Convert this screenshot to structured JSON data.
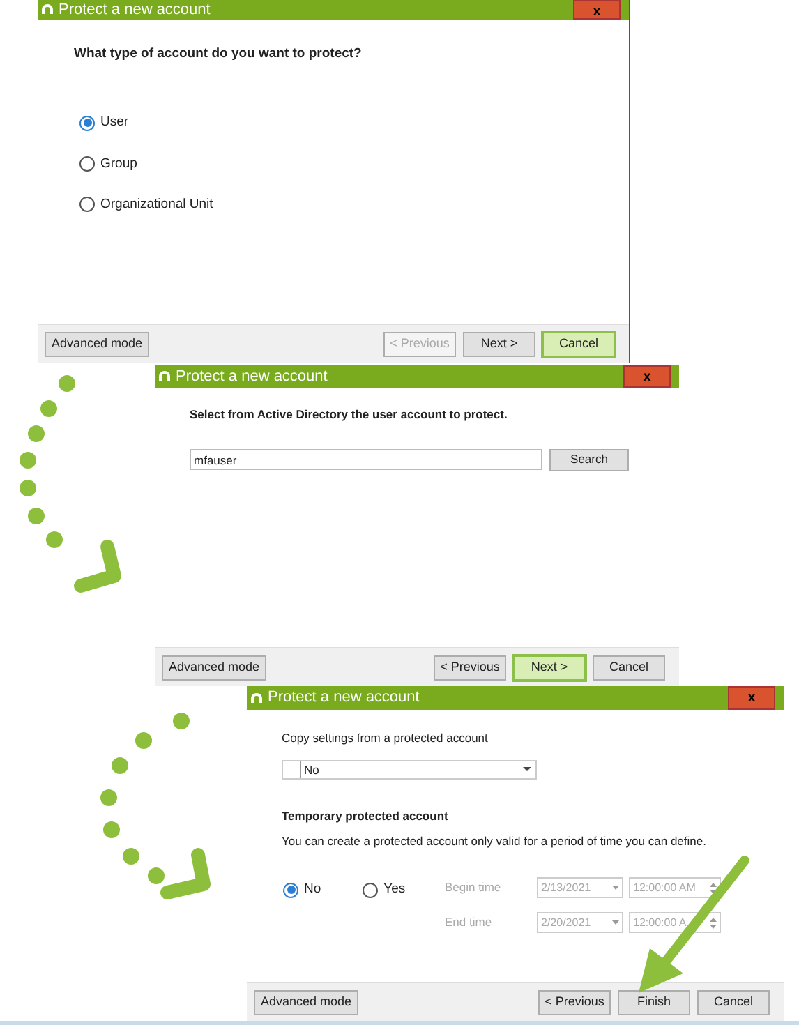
{
  "dialogs": [
    {
      "kind": "account_type",
      "title": "Protect a new account",
      "close": "x",
      "question": "What type of account do you want to protect?",
      "options": [
        {
          "label": "User",
          "selected": true
        },
        {
          "label": "Group",
          "selected": false
        },
        {
          "label": "Organizational Unit",
          "selected": false
        }
      ],
      "advanced": "Advanced mode",
      "buttons": [
        {
          "label": "< Previous",
          "disabled": true,
          "highlighted": false
        },
        {
          "label": "Next >",
          "disabled": false,
          "highlighted": false
        },
        {
          "label": "Cancel",
          "disabled": false,
          "highlighted": true
        }
      ]
    },
    {
      "kind": "search",
      "title": "Protect a new account",
      "close": "x",
      "question": "Select from Active Directory the user account to protect.",
      "search_value": "mfauser",
      "search_button": "Search",
      "advanced": "Advanced mode",
      "buttons": [
        {
          "label": "< Previous",
          "disabled": false,
          "highlighted": false
        },
        {
          "label": "Next >",
          "disabled": false,
          "highlighted": true
        },
        {
          "label": "Cancel",
          "disabled": false,
          "highlighted": false
        }
      ]
    },
    {
      "kind": "settings",
      "title": "Protect a new account",
      "close": "x",
      "copy_label": "Copy settings from a protected account",
      "copy_value": "No",
      "temp_heading": "Temporary protected account",
      "temp_desc": "You can create a protected account only valid for a period of time you can define.",
      "options": [
        {
          "label": "No",
          "selected": true
        },
        {
          "label": "Yes",
          "selected": false
        }
      ],
      "times": [
        {
          "label": "Begin time",
          "date": "2/13/2021",
          "time": "12:00:00 AM",
          "disabled": true
        },
        {
          "label": "End time",
          "date": "2/20/2021",
          "time": "12:00:00 A",
          "disabled": true
        }
      ],
      "advanced": "Advanced mode",
      "buttons": [
        {
          "label": "< Previous",
          "disabled": false,
          "highlighted": false
        },
        {
          "label": "Finish",
          "disabled": false,
          "highlighted": false
        },
        {
          "label": "Cancel",
          "disabled": false,
          "highlighted": false
        }
      ]
    }
  ]
}
